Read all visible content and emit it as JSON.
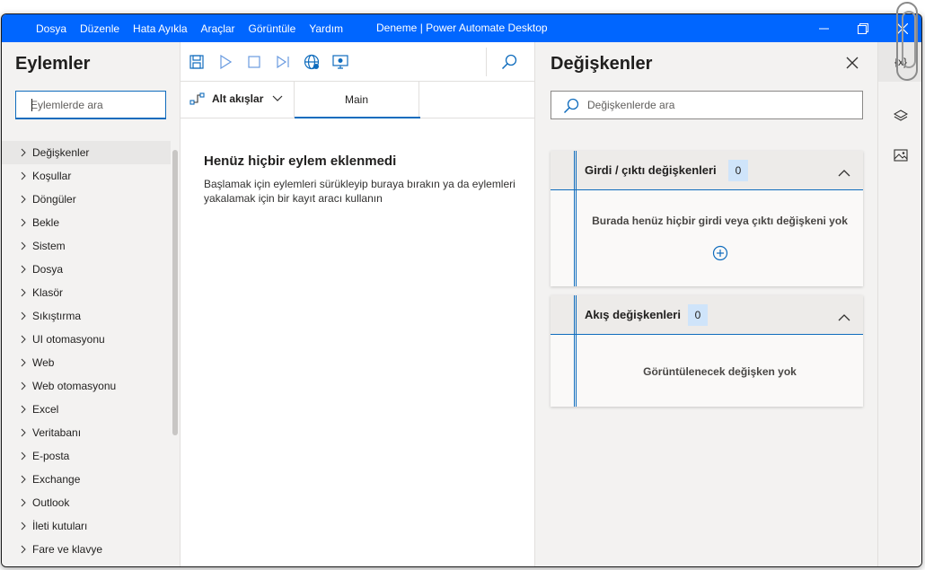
{
  "titlebar": {
    "menu": [
      "Dosya",
      "Düzenle",
      "Hata Ayıkla",
      "Araçlar",
      "Görüntüle",
      "Yardım"
    ],
    "title": "Deneme | Power Automate Desktop"
  },
  "actions_panel": {
    "title": "Eylemler",
    "search_placeholder": "Eylemlerde ara",
    "items": [
      "Değişkenler",
      "Koşullar",
      "Döngüler",
      "Bekle",
      "Sistem",
      "Dosya",
      "Klasör",
      "Sıkıştırma",
      "UI otomasyonu",
      "Web",
      "Web otomasyonu",
      "Excel",
      "Veritabanı",
      "E-posta",
      "Exchange",
      "Outlook",
      "İleti kutuları",
      "Fare ve klavye"
    ]
  },
  "designer": {
    "subflows_label": "Alt akışlar",
    "tab_main": "Main",
    "empty_title": "Henüz hiçbir eylem eklenmedi",
    "empty_desc": "Başlamak için eylemleri sürükleyip buraya bırakın ya da eylemleri yakalamak için bir kayıt aracı kullanın"
  },
  "variables_panel": {
    "title": "Değişkenler",
    "search_placeholder": "Değişkenlerde ara",
    "io_section": {
      "title": "Girdi / çıktı değişkenleri",
      "count": "0",
      "empty": "Burada henüz hiçbir girdi veya çıktı değişkeni yok"
    },
    "flow_section": {
      "title": "Akış değişkenleri",
      "count": "0",
      "empty": "Görüntülenecek değişken yok"
    }
  },
  "rail": {
    "variables_label": "{x}"
  },
  "colors": {
    "titlebar": "#0066ff",
    "accent": "#0f6cbd",
    "badge": "#cfe4fa"
  }
}
